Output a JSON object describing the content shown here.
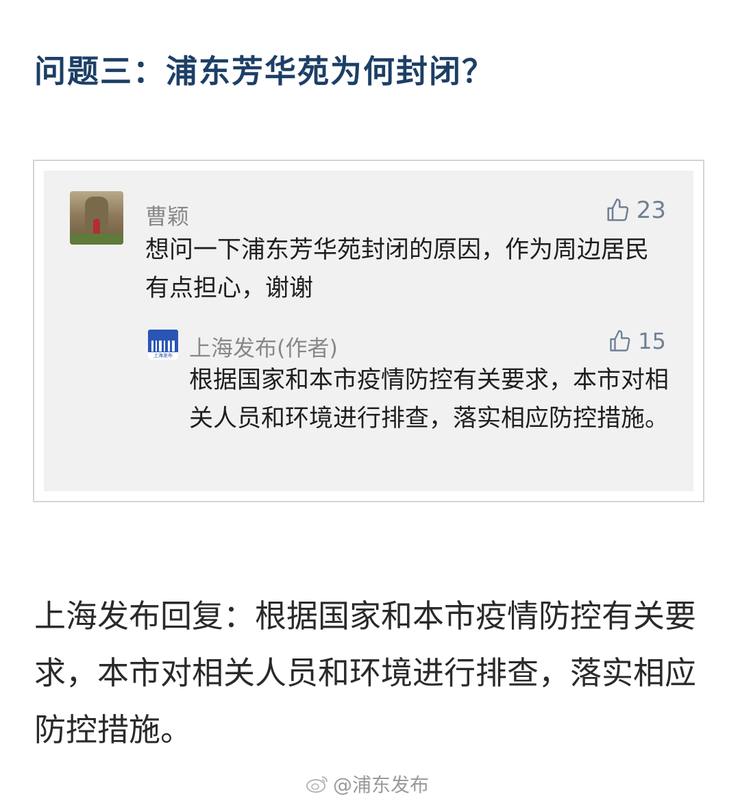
{
  "heading": "问题三：浦东芳华苑为何封闭？",
  "comment": {
    "author": "曹颖",
    "likes": "23",
    "text": "想问一下浦东芳华苑封闭的原因，作为周边居民有点担心，谢谢",
    "avatar_icon": "user-avatar-photo"
  },
  "reply": {
    "author": "上海发布(作者)",
    "logo_caption": "上海发布",
    "likes": "15",
    "text": "根据国家和本市疫情防控有关要求，本市对相关人员和环境进行排查，落实相应防控措施。",
    "logo_icon": "shanghai-fabu-logo"
  },
  "body_text": "上海发布回复：根据国家和本市疫情防控有关要求，本市对相关人员和环境进行排查，落实相应防控措施。",
  "watermark": "@浦东发布",
  "colors": {
    "heading": "#1d3f66",
    "like_icon": "#6f7f95",
    "logo_bg": "#2a55b5"
  }
}
